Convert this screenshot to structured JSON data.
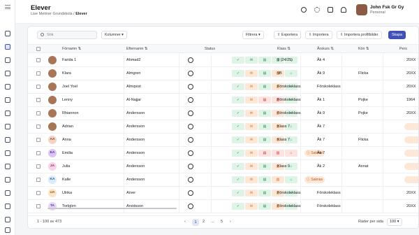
{
  "header": {
    "title": "Elever",
    "breadcrumb_school": "Lise Meitner Grundskola",
    "breadcrumb_sep": "/",
    "breadcrumb_current": "Elever",
    "user_name": "John Fsk Gr Gy",
    "user_role": "Personal"
  },
  "toolbar": {
    "search_placeholder": "Sök",
    "columns_label": "Kolumner",
    "filter_label": "Filtrera",
    "export_label": "Exportera",
    "import_label": "Importera",
    "import_profiles_label": "Importera profilbilder",
    "create_label": "Skapa"
  },
  "table": {
    "columns": [
      "Förnamn",
      "Efternamn",
      "Status",
      "Klass",
      "Årskurs",
      "Kön",
      "Pers"
    ],
    "status_missing_label": "Saknas",
    "rows": [
      {
        "first": "Farida 1",
        "last": "Ahmad2",
        "klass": "9 (24/25)",
        "arskurs": "Åk 4",
        "kon": "",
        "pers": "20XX",
        "initials": "",
        "status": [
          "g",
          "g",
          "g",
          "g",
          "g"
        ],
        "klass_missing": false
      },
      {
        "first": "Klara",
        "last": "Almgren",
        "klass": "9B",
        "arskurs": "Åk 9",
        "kon": "Flicka",
        "pers": "20XX",
        "initials": "",
        "status": [
          "g",
          "o",
          "g",
          "o",
          "g"
        ],
        "klass_missing": false
      },
      {
        "first": "Joel Yoel",
        "last": "Almqvist",
        "klass": "Förskoleklass",
        "arskurs": "Förskoleklass",
        "kon": "",
        "pers": "20XX",
        "initials": "",
        "status": [
          "g",
          "o",
          "g",
          "o",
          "g"
        ],
        "klass_missing": false
      },
      {
        "first": "Lenny",
        "last": "Al-Najjar",
        "klass": "Förskoleklass",
        "arskurs": "Åk 1",
        "kon": "Pojke",
        "pers": "1964",
        "initials": "",
        "status": [
          "g",
          "o",
          "r",
          "r",
          "g"
        ],
        "klass_missing": false
      },
      {
        "first": "Rhiannon",
        "last": "Andersson",
        "klass": "Förskoleklass",
        "arskurs": "Åk 9",
        "kon": "Pojke",
        "pers": "20XX",
        "initials": "",
        "status": [
          "g",
          "o",
          "g",
          "o",
          "g"
        ],
        "klass_missing": false
      },
      {
        "first": "Adrian",
        "last": "Andersson",
        "klass": "Klass 7",
        "arskurs": "Åk 7",
        "kon": "",
        "pers": "",
        "initials": "",
        "status": [
          "g",
          "o",
          "g",
          "o",
          "g"
        ],
        "klass_missing": false
      },
      {
        "first": "Anna",
        "last": "Andersson",
        "klass": "Klass 7",
        "arskurs": "Åk 7",
        "kon": "Flicka",
        "pers": "",
        "initials": "AA",
        "status": [
          "g",
          "o",
          "g",
          "o",
          "g"
        ],
        "klass_missing": false
      },
      {
        "first": "Emilia",
        "last": "Andersson",
        "klass": "",
        "arskurs": "Åk 7",
        "kon": "",
        "pers": "",
        "initials": "EA",
        "status": [
          "g",
          "o",
          "r",
          "r",
          "r"
        ],
        "klass_missing": true
      },
      {
        "first": "Julia",
        "last": "Andersson",
        "klass": "Klass 9",
        "arskurs": "Åk 2",
        "kon": "Annat",
        "pers": "",
        "initials": "JA",
        "status": [
          "g",
          "o",
          "g",
          "o",
          "g"
        ],
        "klass_missing": false
      },
      {
        "first": "Kalle",
        "last": "Andersson",
        "klass": "",
        "arskurs": "",
        "kon": "",
        "pers": "",
        "initials": "KA",
        "status": [
          "g",
          "o",
          "g",
          "o",
          "g"
        ],
        "klass_missing": true
      },
      {
        "first": "Ulrika",
        "last": "Arver",
        "klass": "Förskoleklass",
        "arskurs": "Förskoleklass",
        "kon": "",
        "pers": "20XX",
        "initials": "UA",
        "status": [
          "g",
          "o",
          "g",
          "o",
          "g"
        ],
        "klass_missing": false
      },
      {
        "first": "Torbjörn",
        "last": "Arvidsson",
        "klass": "Förskoleklass",
        "arskurs": "Förskoleklass",
        "kon": "",
        "pers": "20XX",
        "initials": "TA",
        "status": [
          "g",
          "o",
          "g",
          "o",
          "g"
        ],
        "klass_missing": false
      }
    ]
  },
  "footer": {
    "range": "1 - 100 av 473",
    "page1": "1",
    "page2": "2",
    "ellipsis": "...",
    "page_last": "5",
    "rows_per_page_label": "Rader per sida",
    "rows_per_page_value": "100"
  },
  "colors": {
    "accent": "#3f51b5",
    "status_ok": "#dff3e6",
    "status_warn": "#fde7d7",
    "status_error": "#fde2e2"
  }
}
